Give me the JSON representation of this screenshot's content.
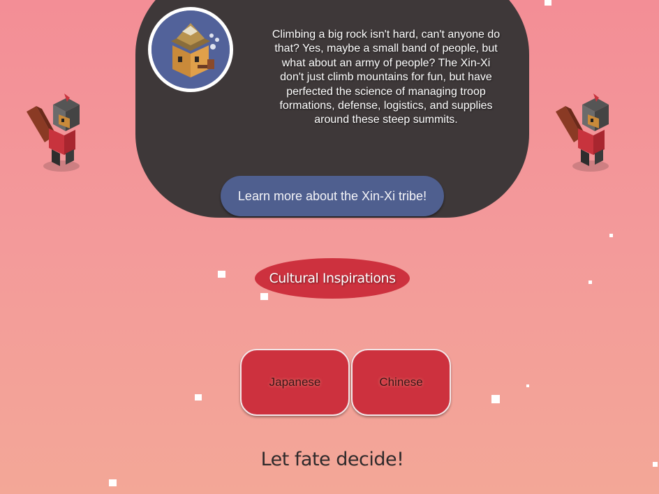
{
  "info_card": {
    "text": "Climbing a big rock isn't hard, can't anyone do that? Yes, maybe a small band of people, but what about an army of people? The Xin-Xi don't just climb mountains for fun, but have perfected the science of managing troop formations, defense, logistics, and supplies around these steep summits.",
    "button_label": "Learn more about the Xin-Xi tribe!"
  },
  "section": {
    "title": "Cultural Inspirations"
  },
  "choices": {
    "japanese_label": "Japanese",
    "chinese_label": "Chinese"
  },
  "random_link": {
    "label": "Let fate decide!"
  },
  "icons": {
    "avatar": "explorer-avatar-icon",
    "mascot_left": "warrior-bird-icon",
    "mascot_right": "warrior-bird-icon"
  },
  "colors": {
    "background_top": "#f38e96",
    "background_bottom": "#f3a797",
    "card": "#3e3839",
    "learn_button": "#4f5f8f",
    "accent_red": "#cd313e"
  }
}
